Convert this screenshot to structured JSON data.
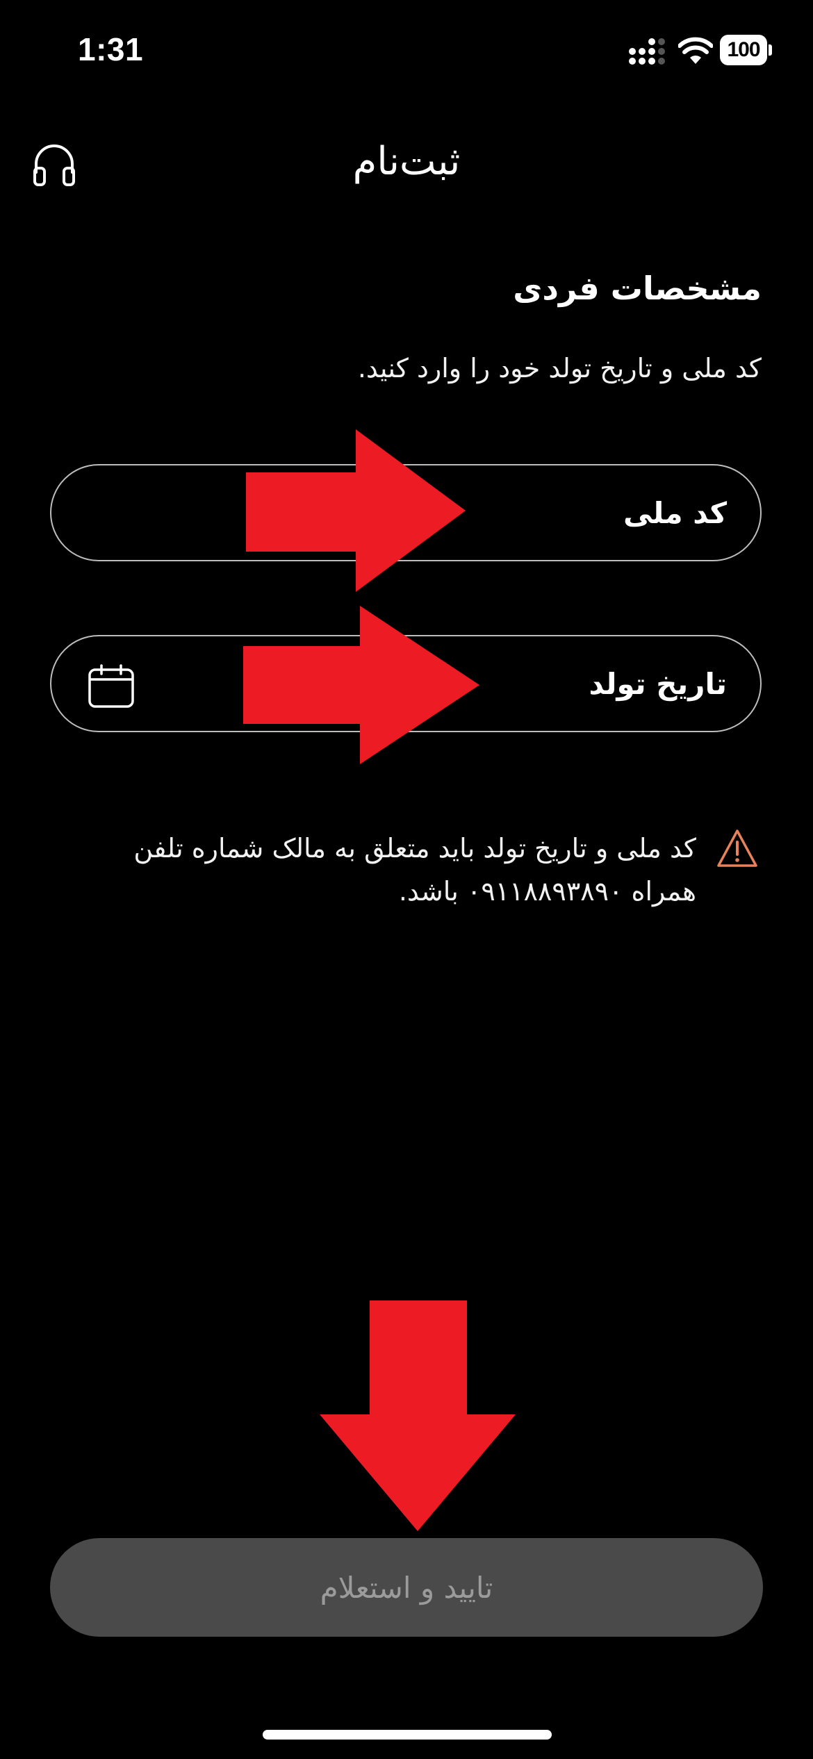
{
  "status_bar": {
    "time": "1:31",
    "battery": "100",
    "signal_icon": "cellular-signal-icon",
    "wifi_icon": "wifi-icon"
  },
  "header": {
    "title": "ثبت‌نام",
    "support_icon": "headphones-icon"
  },
  "section": {
    "title": "مشخصات فردی",
    "description": "کد ملی و تاریخ تولد خود را وارد کنید."
  },
  "fields": {
    "national_code": {
      "label": "کد ملی"
    },
    "birth_date": {
      "label": "تاریخ تولد",
      "icon": "calendar-icon"
    }
  },
  "warning": {
    "icon": "warning-triangle-icon",
    "line1": "کد ملی و تاریخ تولد باید متعلق به مالک شماره تلفن",
    "line2": "همراه ۰۹۱۱۸۸۹۳۸۹۰ باشد.",
    "color": "#e8825a"
  },
  "submit": {
    "label": "تایید و استعلام"
  },
  "colors": {
    "background": "#000000",
    "annotation_arrow": "#ed1c24",
    "button_bg": "#4a4a4a",
    "button_text": "#9b9b9b"
  }
}
